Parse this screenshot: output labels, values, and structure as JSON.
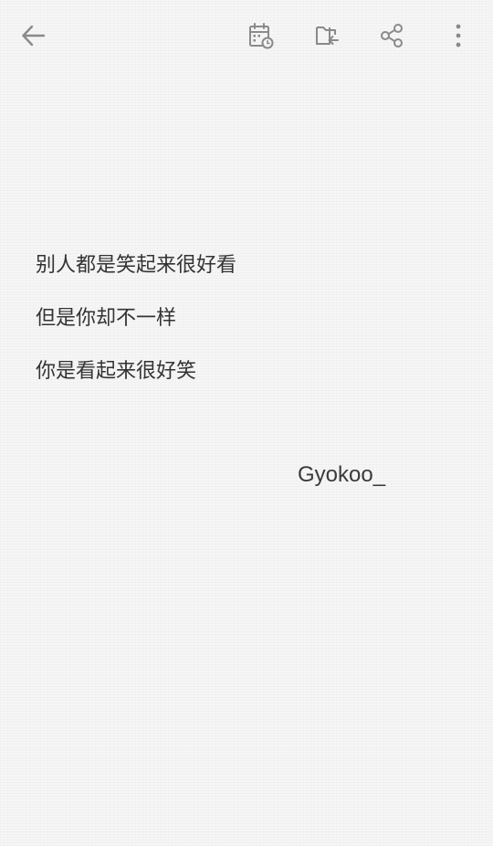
{
  "toolbar": {
    "back_icon": "arrow-left-icon",
    "reminder_icon": "calendar-clock-icon",
    "move_icon": "folder-move-icon",
    "share_icon": "share-icon",
    "more_icon": "more-vertical-icon",
    "icon_color": "#8a8a8a"
  },
  "note": {
    "lines": [
      "别人都是笑起来很好看",
      "但是你却不一样",
      "你是看起来很好笑"
    ],
    "signature": "Gyokoo_"
  },
  "colors": {
    "background": "#f6f6f6",
    "text": "#333333"
  }
}
